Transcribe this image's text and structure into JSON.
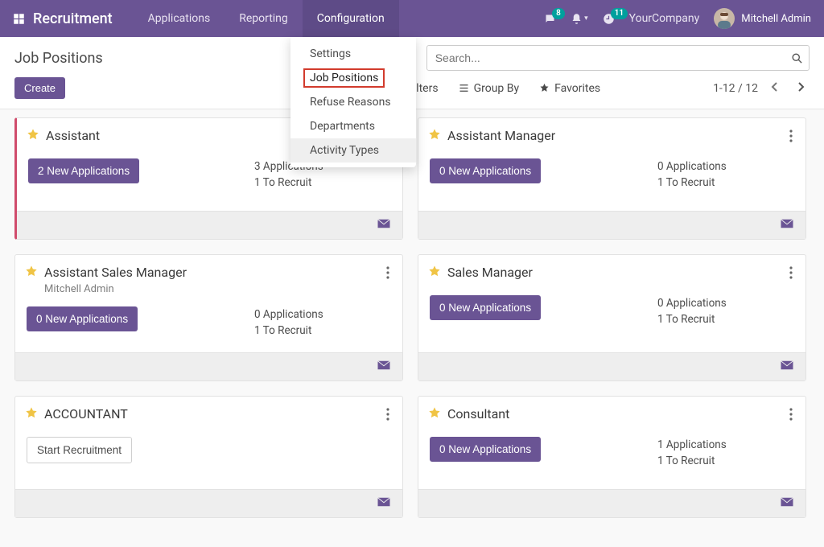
{
  "colors": {
    "accent": "#6a5494",
    "badge": "#00a09d"
  },
  "brand": "Recruitment",
  "nav": {
    "applications": "Applications",
    "reporting": "Reporting",
    "configuration": "Configuration"
  },
  "config_menu": {
    "settings": "Settings",
    "job_positions": "Job Positions",
    "refuse_reasons": "Refuse Reasons",
    "departments": "Departments",
    "activity_types": "Activity Types"
  },
  "systray": {
    "messages_count": "8",
    "activities_count": "11",
    "company": "YourCompany",
    "user": "Mitchell Admin"
  },
  "page_title": "Job Positions",
  "search": {
    "placeholder": "Search..."
  },
  "buttons": {
    "create": "Create"
  },
  "filters": {
    "filters": "Filters",
    "groupby": "Group By",
    "favorites": "Favorites"
  },
  "pager": {
    "range": "1-12 / 12"
  },
  "labels": {
    "new_apps_suffix": "New Applications",
    "apps_suffix": "Applications",
    "recruit_suffix": "To Recruit",
    "start_recruitment": "Start Recruitment"
  },
  "cards": [
    {
      "title": "Assistant",
      "accent": true,
      "button": {
        "type": "purple",
        "count": 2
      },
      "applications": 3,
      "to_recruit": 1
    },
    {
      "title": "Assistant Manager",
      "button": {
        "type": "purple",
        "count": 0
      },
      "applications": 0,
      "to_recruit": 1
    },
    {
      "title": "Assistant Sales Manager",
      "subtitle": "Mitchell Admin",
      "button": {
        "type": "purple",
        "count": 0
      },
      "applications": 0,
      "to_recruit": 1
    },
    {
      "title": "Sales Manager",
      "button": {
        "type": "purple",
        "count": 0
      },
      "applications": 0,
      "to_recruit": 1
    },
    {
      "title": "ACCOUNTANT",
      "button": {
        "type": "white"
      }
    },
    {
      "title": "Consultant",
      "button": {
        "type": "purple",
        "count": 0
      },
      "applications": 1,
      "to_recruit": 1
    }
  ]
}
